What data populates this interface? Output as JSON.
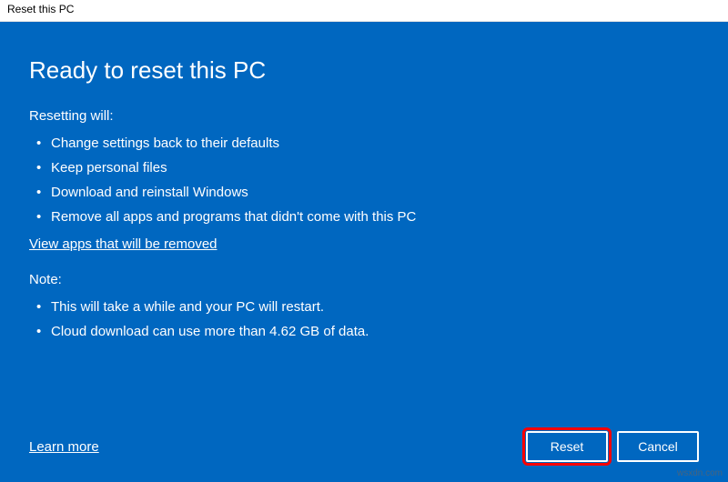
{
  "window": {
    "title": "Reset this PC"
  },
  "main": {
    "heading": "Ready to reset this PC",
    "resetting_label": "Resetting will:",
    "resetting_items": [
      "Change settings back to their defaults",
      "Keep personal files",
      "Download and reinstall Windows",
      "Remove all apps and programs that didn't come with this PC"
    ],
    "view_apps_link": "View apps that will be removed",
    "note_label": "Note:",
    "note_items": [
      "This will take a while and your PC will restart.",
      "Cloud download can use more than 4.62 GB of data."
    ]
  },
  "footer": {
    "learn_more": "Learn more",
    "reset_label": "Reset",
    "cancel_label": "Cancel"
  },
  "watermark": "wsxdn.com"
}
